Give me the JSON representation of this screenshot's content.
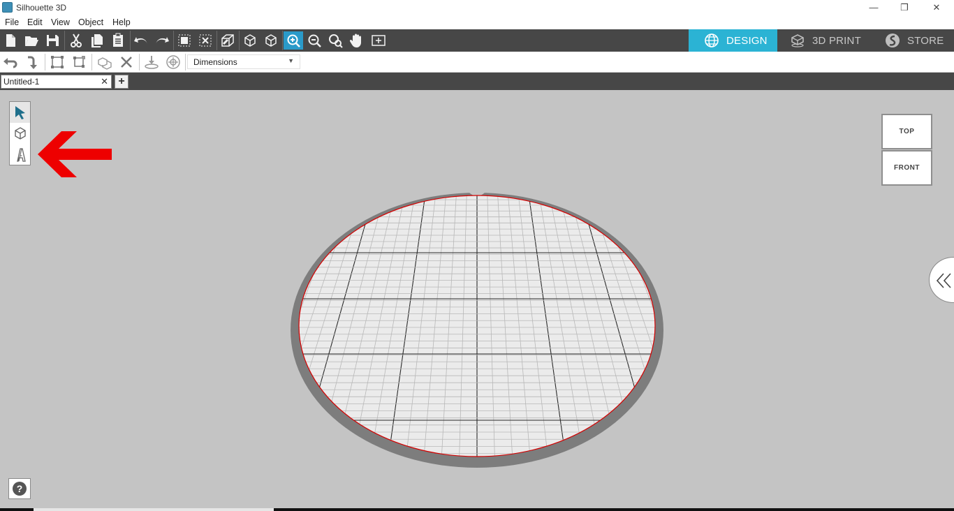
{
  "window": {
    "title": "Silhouette 3D",
    "minimize": "—",
    "restore": "❐",
    "close": "✕"
  },
  "menu": [
    {
      "label": "File"
    },
    {
      "label": "Edit"
    },
    {
      "label": "View"
    },
    {
      "label": "Object"
    },
    {
      "label": "Help"
    }
  ],
  "toolbar": {
    "buttons": [
      "new-file",
      "open-file",
      "save",
      "cut",
      "copy",
      "paste",
      "undo",
      "redo",
      "group",
      "ungroup",
      "extrude",
      "box-view",
      "box-view-2",
      "zoom-in",
      "zoom-out",
      "zoom-fit",
      "pan",
      "fit-page"
    ],
    "active": "zoom-in"
  },
  "modes": {
    "design": {
      "label": "DESIGN",
      "icon": "globe-icon",
      "active": true
    },
    "print": {
      "label": "3D PRINT",
      "icon": "printer-icon",
      "active": false
    },
    "store": {
      "label": "STORE",
      "icon": "silhouette-logo-icon",
      "active": false
    }
  },
  "toolbar2": {
    "dimensions": {
      "value": "Dimensions"
    }
  },
  "tabs": {
    "document": {
      "label": "Untitled-1",
      "close": "✕"
    },
    "add": "+"
  },
  "viewcube": {
    "top": "TOP",
    "front": "FRONT"
  },
  "help": {
    "label": "?"
  },
  "colors": {
    "accent": "#2a9ac9",
    "toolbar_bg": "#474747",
    "canvas_bg": "#c4c4c4",
    "plate_rim": "#7d7d7d",
    "plate_surface": "#ebebeb",
    "plate_edge": "#d40000",
    "arrow": "#ee0000"
  }
}
